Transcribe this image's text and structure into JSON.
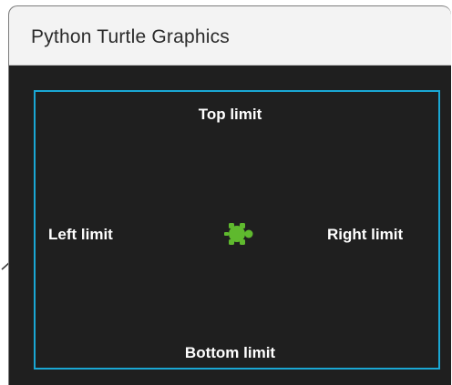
{
  "window": {
    "title": "Python Turtle Graphics"
  },
  "canvas": {
    "labels": {
      "top": "Top limit",
      "bottom": "Bottom limit",
      "left": "Left limit",
      "right": "Right limit"
    },
    "boundary_color": "#1aa7d4",
    "background_color": "#1f1f1f",
    "turtle_color": "#5fb92e",
    "turtle_icon": "turtle-icon"
  }
}
